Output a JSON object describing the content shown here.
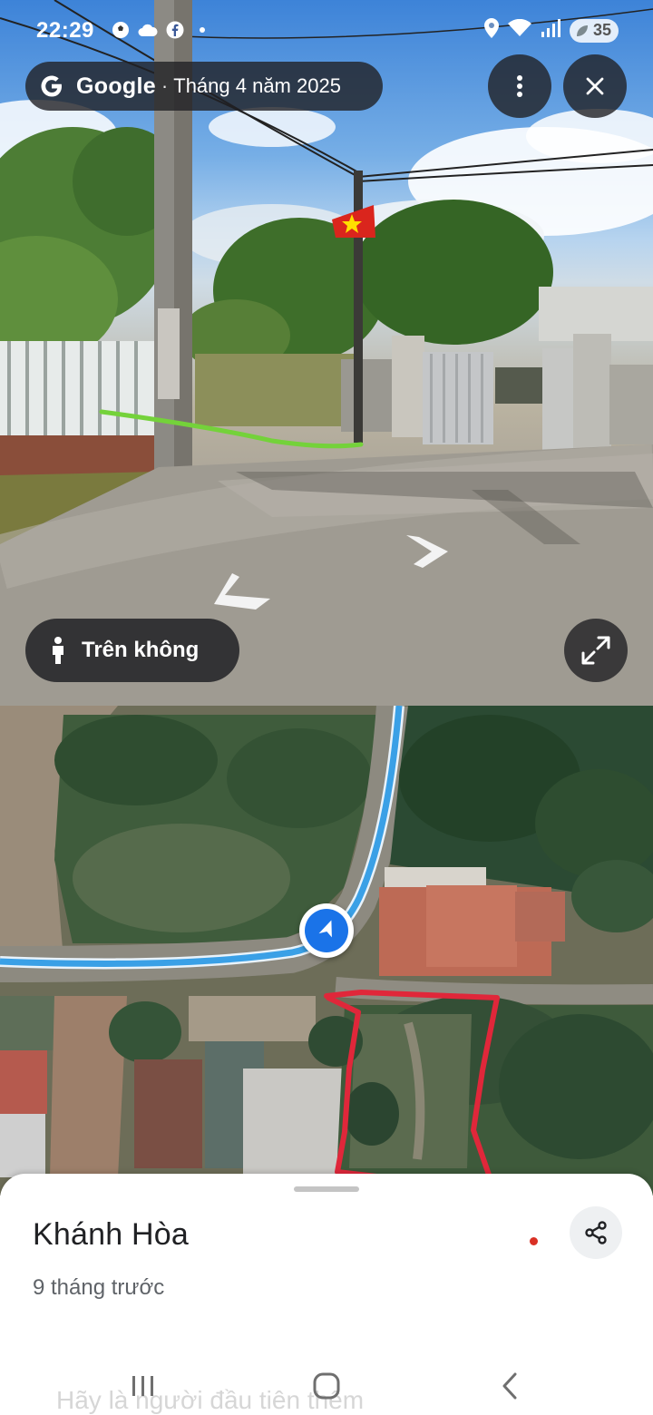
{
  "status_bar": {
    "time": "22:29",
    "battery": "35",
    "icons": [
      "soccer-ball-icon",
      "cloud-icon",
      "facebook-icon",
      "dot-icon",
      "location-icon",
      "wifi-icon",
      "signal-icon",
      "battery-icon"
    ]
  },
  "street_view": {
    "brand": "Google",
    "separator": "·",
    "capture_date": "Tháng 4 năm 2025",
    "aerial_button_label": "Trên không",
    "icons": [
      "google-logo-icon",
      "more-vert-icon",
      "close-icon",
      "pegman-icon",
      "expand-icon",
      "nav-arrow-icon"
    ]
  },
  "place_sheet": {
    "title": "Khánh Hòa",
    "time_ago": "9 tháng trước",
    "faded_prompt": "Hãy là người đầu tiên thêm",
    "icons": [
      "share-icon"
    ]
  },
  "colors": {
    "route_blue": "#3aa0e6",
    "marker_blue": "#1a73e8",
    "annotation_red": "#e0273a",
    "path_green": "#74d23a",
    "overlay_dark": "#202124"
  }
}
